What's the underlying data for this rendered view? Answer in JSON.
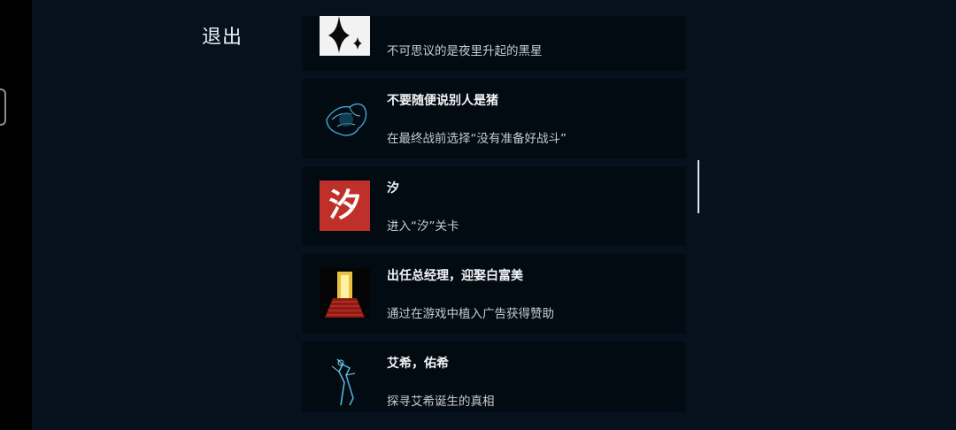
{
  "exit_label": "退出",
  "achievements": [
    {
      "title": "",
      "desc": "不可思议的是夜里升起的黑星",
      "icon": "black-star-icon"
    },
    {
      "title": "不要随便说别人是猪",
      "desc": "在最终战前选择“没有准备好战斗”",
      "icon": "blue-creature-icon"
    },
    {
      "title": "汐",
      "desc": "进入“汐”关卡",
      "icon": "xi-character-icon",
      "icon_text": "汐"
    },
    {
      "title": "出任总经理，迎娶白富美",
      "desc": "通过在游戏中植入广告获得赞助",
      "icon": "golden-door-stairs-icon"
    },
    {
      "title": "艾希，佑希",
      "desc": "探寻艾希诞生的真相",
      "icon": "blue-sword-figure-icon"
    }
  ],
  "colors": {
    "background": "#05121e",
    "card": "#020a12",
    "text": "#f2f4f6",
    "accent_red": "#c0302b",
    "accent_blue": "#4fb8d8",
    "accent_gold": "#e8c240"
  }
}
